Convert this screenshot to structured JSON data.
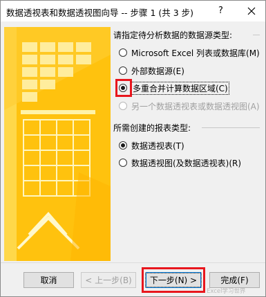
{
  "window": {
    "title": "数据透视表和数据透视图向导 -- 步骤 1 (共 3 步)",
    "help_label": "?",
    "close_label": "×"
  },
  "source": {
    "heading": "请指定待分析数据的数据源类型:",
    "options": [
      {
        "label": "Microsoft Excel 列表或数据库(M)",
        "checked": false,
        "disabled": false
      },
      {
        "label": "外部数据源(E)",
        "checked": false,
        "disabled": false
      },
      {
        "label": "多重合并计算数据区域(C)",
        "checked": true,
        "disabled": false
      },
      {
        "label": "另一个数据透视表或数据透视图(A)",
        "checked": false,
        "disabled": true
      }
    ]
  },
  "report": {
    "heading": "所需创建的报表类型:",
    "options": [
      {
        "label": "数据透视表(T)",
        "checked": true,
        "disabled": false
      },
      {
        "label": "数据透视图(及数据透视表)(R)",
        "checked": false,
        "disabled": false
      }
    ]
  },
  "buttons": {
    "cancel": "取消",
    "back": "< 上一步(B)",
    "next": "下一步(N) >",
    "finish": "完成(F)"
  },
  "watermark": "Excel学习世界",
  "colors": {
    "highlight": "#e8161d",
    "art_yellow": "#ffc20e",
    "art_pale": "#fff4b3"
  }
}
